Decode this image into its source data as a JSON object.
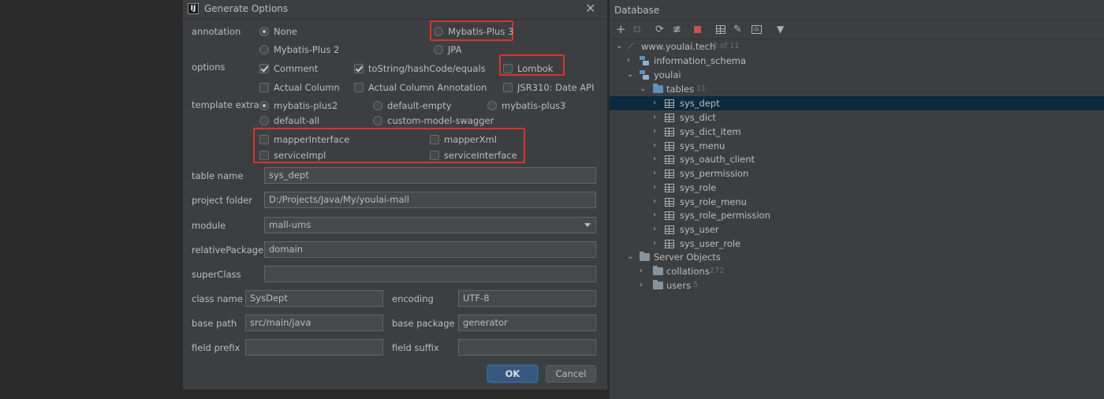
{
  "dialog": {
    "title": "Generate Options",
    "annotation_label": "annotation",
    "annotation_options": [
      {
        "label": "None",
        "selected": true
      },
      {
        "label": "Mybatis-Plus 3",
        "selected": false
      },
      {
        "label": "Mybatis-Plus 2",
        "selected": false
      },
      {
        "label": "JPA",
        "selected": false
      }
    ],
    "options_label": "options",
    "options": [
      {
        "label": "Comment",
        "checked": true
      },
      {
        "label": "toString/hashCode/equals",
        "checked": true
      },
      {
        "label": "Lombok",
        "checked": false
      },
      {
        "label": "Actual Column",
        "checked": false
      },
      {
        "label": "Actual Column Annotation",
        "checked": false
      },
      {
        "label": "JSR310: Date API",
        "checked": false
      }
    ],
    "template_label": "template extra",
    "templates": [
      {
        "label": "mybatis-plus2",
        "selected": true
      },
      {
        "label": "default-empty",
        "selected": false
      },
      {
        "label": "mybatis-plus3",
        "selected": false
      },
      {
        "label": "default-all",
        "selected": false
      },
      {
        "label": "custom-model-swagger",
        "selected": false
      }
    ],
    "extras": [
      {
        "label": "mapperInterface",
        "checked": false
      },
      {
        "label": "mapperXml",
        "checked": false
      },
      {
        "label": "serviceImpl",
        "checked": false
      },
      {
        "label": "serviceInterface",
        "checked": false
      }
    ],
    "table_name": {
      "label": "table name",
      "value": "sys_dept"
    },
    "project_folder": {
      "label": "project folder",
      "value": "D:/Projects/Java/My/youlai-mall"
    },
    "module": {
      "label": "module",
      "value": "mall-ums"
    },
    "relative_package": {
      "label": "relativePackage",
      "value": "domain"
    },
    "super_class": {
      "label": "superClass",
      "value": ""
    },
    "class_name": {
      "label": "class name",
      "value": "SysDept"
    },
    "encoding": {
      "label": "encoding",
      "value": "UTF-8"
    },
    "base_path": {
      "label": "base path",
      "value": "src/main/java"
    },
    "base_package": {
      "label": "base package",
      "value": "generator"
    },
    "field_prefix": {
      "label": "field prefix",
      "value": ""
    },
    "field_suffix": {
      "label": "field suffix",
      "value": ""
    },
    "ok_label": "OK",
    "cancel_label": "Cancel",
    "highlight_color": "#d9342b"
  },
  "database": {
    "title": "Database",
    "toolbar_icons": [
      "add-icon",
      "copy-icon",
      "refresh-icon",
      "edit-properties-icon",
      "stop-icon",
      "table-icon",
      "edit-icon",
      "sql-console-icon",
      "filter-icon"
    ],
    "tree": {
      "connection": {
        "label": "www.youlai.tech",
        "count": "2 of 11"
      },
      "schemas": [
        {
          "label": "information_schema"
        },
        {
          "label": "youlai"
        }
      ],
      "tables_folder": {
        "label": "tables",
        "count": "11"
      },
      "tables": [
        "sys_dept",
        "sys_dict",
        "sys_dict_item",
        "sys_menu",
        "sys_oauth_client",
        "sys_permission",
        "sys_role",
        "sys_role_menu",
        "sys_role_permission",
        "sys_user",
        "sys_user_role"
      ],
      "selected_table": "sys_dept",
      "server_objects": {
        "label": "Server Objects"
      },
      "collations": {
        "label": "collations",
        "count": "272"
      },
      "users": {
        "label": "users",
        "count": "5"
      }
    },
    "selection_color": "#0d293e"
  }
}
